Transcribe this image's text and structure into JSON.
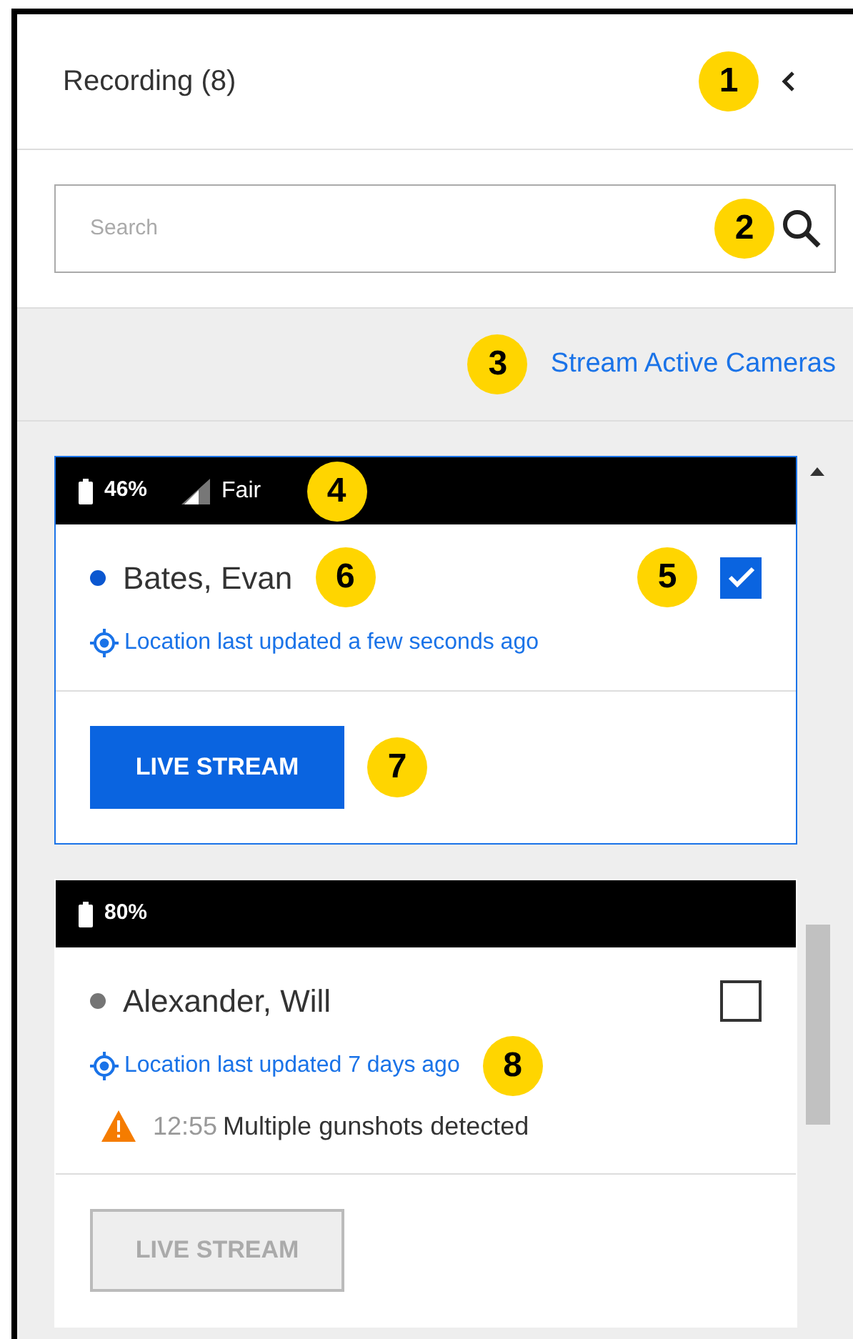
{
  "header": {
    "title": "Recording (8)",
    "callout": "1"
  },
  "search": {
    "placeholder": "Search",
    "callout": "2"
  },
  "stream_link": {
    "label": "Stream Active Cameras",
    "callout": "3"
  },
  "devices": [
    {
      "selected": true,
      "battery": "46%",
      "signal": "Fair",
      "header_callout": "4",
      "color": "#0b57d0",
      "name": "Bates, Evan",
      "name_callout": "6",
      "checked": true,
      "checkbox_callout": "5",
      "location": "Location last updated a few seconds ago",
      "button": {
        "label": "LIVE STREAM",
        "disabled": false
      },
      "button_callout": "7"
    },
    {
      "selected": false,
      "battery": "80%",
      "color": "#757575",
      "name": "Alexander, Will",
      "checked": false,
      "location": "Location last updated 7 days ago",
      "location_callout": "8",
      "alert": {
        "time": "12:55",
        "text": "Multiple gunshots detected"
      },
      "button": {
        "label": "LIVE STREAM",
        "disabled": true
      }
    }
  ]
}
